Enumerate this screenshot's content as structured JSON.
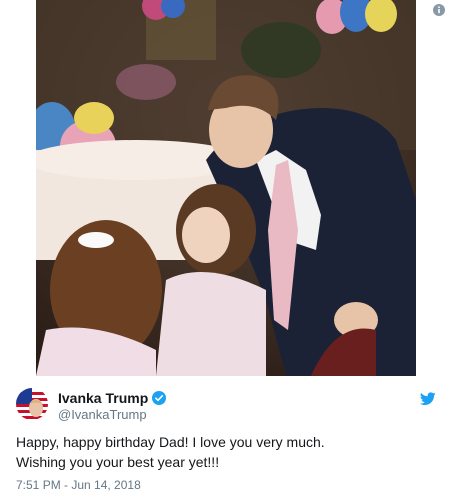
{
  "tweet": {
    "author_name": "Ivanka Trump",
    "handle": "@IvankaTrump",
    "text_lines": [
      "Happy, happy birthday Dad! I love you very much.",
      "Wishing you your best year yet!!!"
    ],
    "timestamp": "7:51 PM - Jun 14, 2018",
    "verified": true
  },
  "colors": {
    "twitter_blue": "#1da1f2",
    "text": "#14171a",
    "secondary_text": "#657786"
  },
  "icons": {
    "info": "info-icon",
    "verified": "verified-badge-icon",
    "brand": "twitter-bird-icon",
    "avatar": "flag-avatar-icon"
  }
}
